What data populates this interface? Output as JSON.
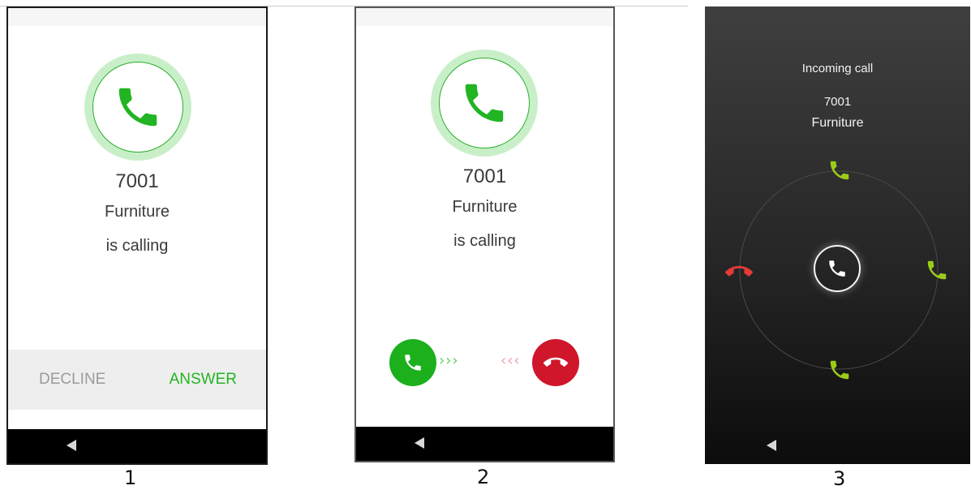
{
  "screens": [
    {
      "number": "7001",
      "name": "Furniture",
      "status": "is calling",
      "decline_label": "DECLINE",
      "answer_label": "ANSWER",
      "caption": "1"
    },
    {
      "number": "7001",
      "name": "Furniture",
      "status": "is calling",
      "answer_chevrons": "›››",
      "decline_chevrons": "‹‹‹",
      "caption": "2"
    },
    {
      "header": "Incoming call",
      "number": "7001",
      "name": "Furniture",
      "caption": "3"
    }
  ],
  "icons": {
    "call": "phone-icon",
    "hangup": "phone-hangup-icon",
    "back": "back-triangle-icon"
  },
  "colors": {
    "answer_green": "#22b422",
    "decline_red": "#d0162b",
    "ring_light_green": "#c9efc9",
    "lime_green": "#9ccc18",
    "slide_red": "#e43a3a"
  }
}
